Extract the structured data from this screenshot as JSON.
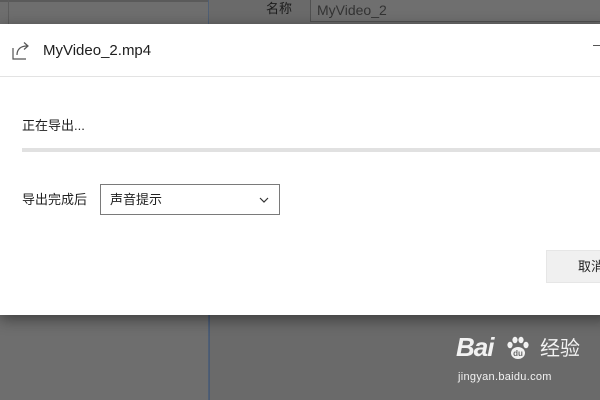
{
  "background_window": {
    "name_label": "名称",
    "name_value": "MyVideo_2"
  },
  "dialog": {
    "title": "MyVideo_2.mp4",
    "icon": "share-export-icon",
    "status_text": "正在导出...",
    "progress_fraction": 0.0,
    "after_export": {
      "label": "导出完成后",
      "selected": "声音提示"
    },
    "cancel_label": "取消"
  },
  "watermark": {
    "logo": "Bai",
    "logo_suffix": "经验",
    "url": "jingyan.baidu.com"
  },
  "colors": {
    "dialog_bg": "#ffffff",
    "overlay": "#6b6b6b",
    "progress_track": "#e1e1e1",
    "button_bg": "#f0f0f0"
  }
}
